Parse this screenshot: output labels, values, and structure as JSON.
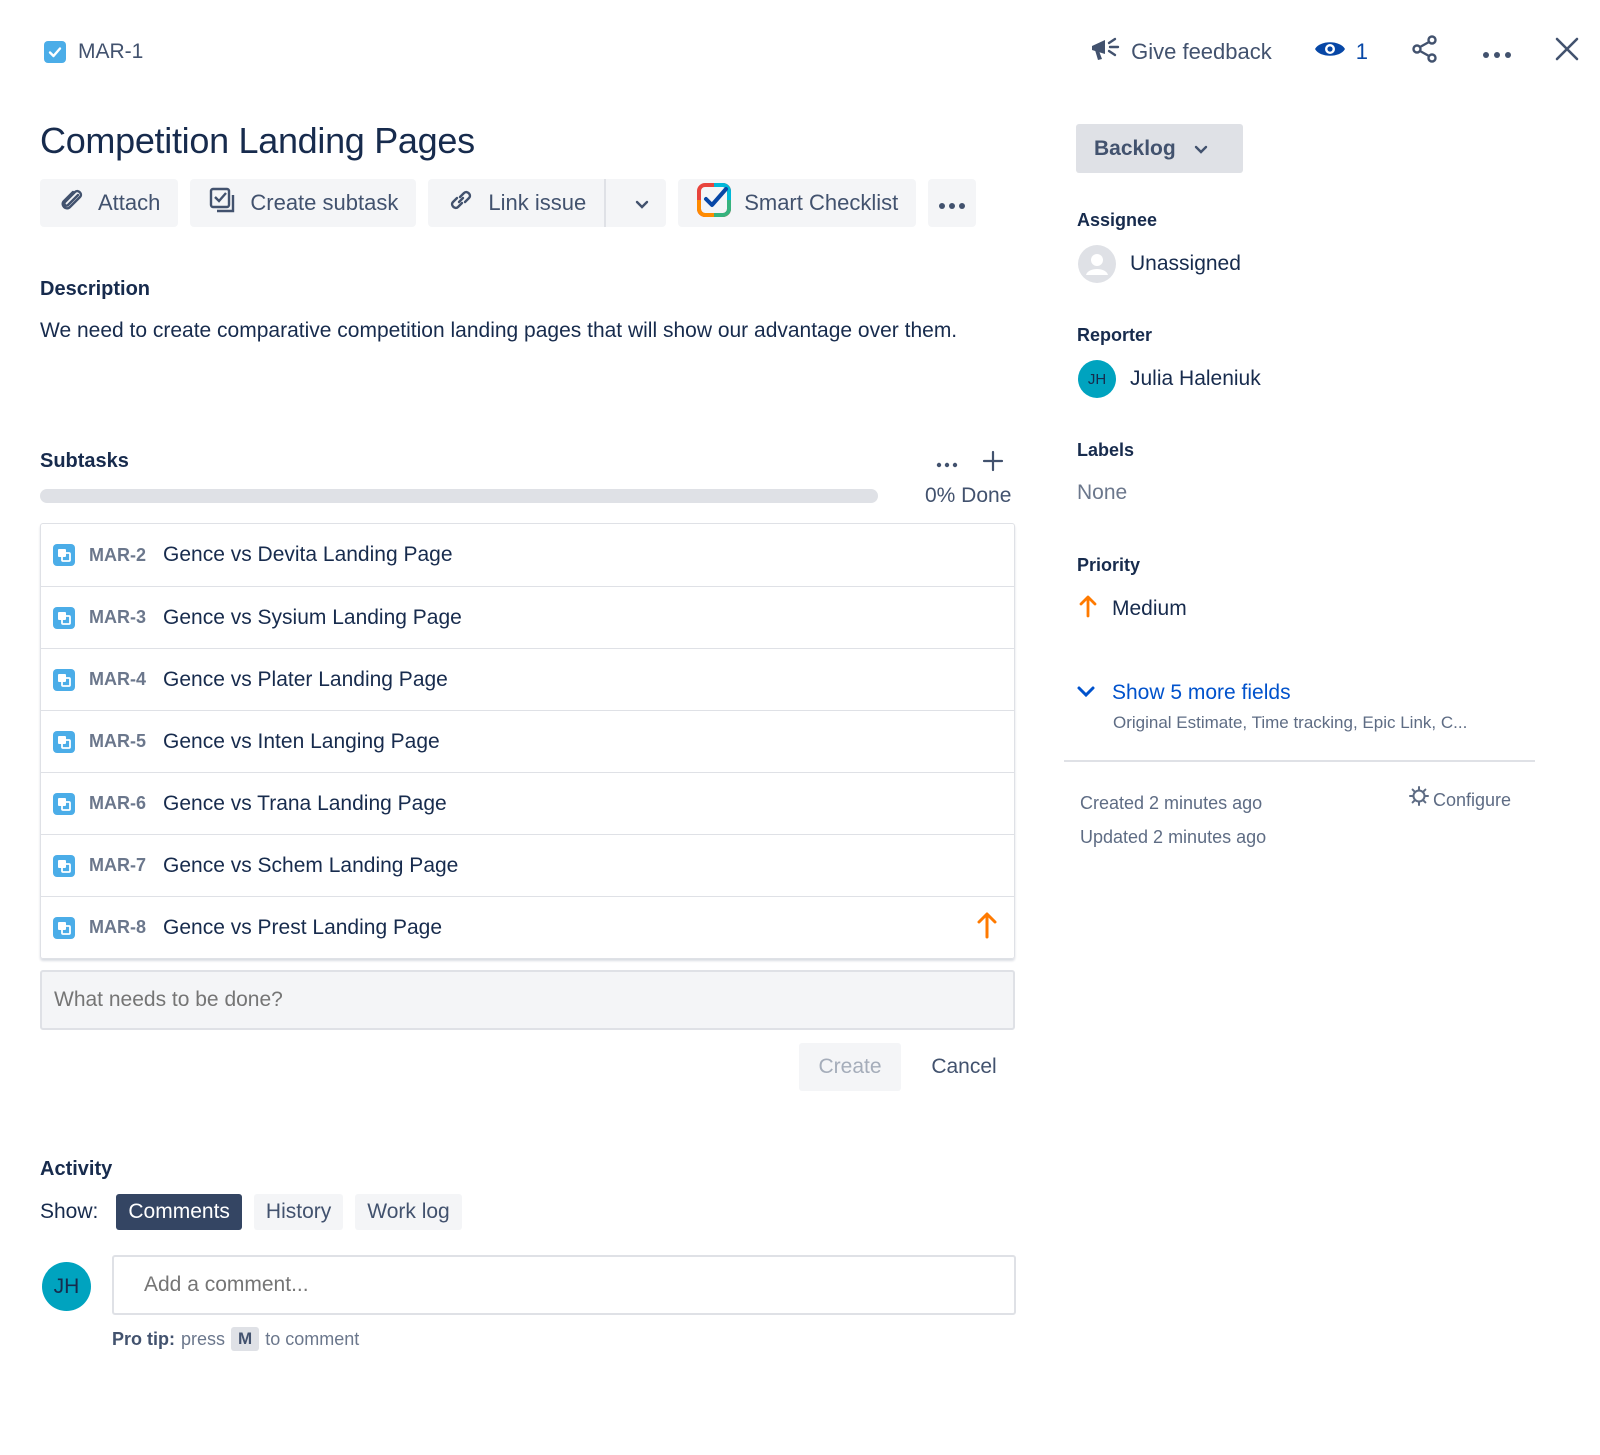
{
  "header": {
    "issue_key": "MAR-1",
    "feedback_label": "Give feedback",
    "watch_count": "1"
  },
  "issue": {
    "title": "Competition Landing Pages"
  },
  "toolbar": {
    "attach": "Attach",
    "create_subtask": "Create subtask",
    "link_issue": "Link issue",
    "smart_checklist": "Smart Checklist"
  },
  "description": {
    "heading": "Description",
    "text": "We need to create comparative competition landing pages that will show our advantage over them."
  },
  "subtasks": {
    "heading": "Subtasks",
    "progress_fraction": 0,
    "done_text": "0% Done",
    "items": [
      {
        "key": "MAR-2",
        "title": "Gence vs Devita Landing Page",
        "priority_icon": ""
      },
      {
        "key": "MAR-3",
        "title": "Gence vs Sysium Landing Page",
        "priority_icon": ""
      },
      {
        "key": "MAR-4",
        "title": "Gence vs Plater Landing Page",
        "priority_icon": ""
      },
      {
        "key": "MAR-5",
        "title": "Gence vs Inten Langing Page",
        "priority_icon": ""
      },
      {
        "key": "MAR-6",
        "title": "Gence vs Trana Landing Page",
        "priority_icon": ""
      },
      {
        "key": "MAR-7",
        "title": "Gence vs Schem Landing Page",
        "priority_icon": ""
      },
      {
        "key": "MAR-8",
        "title": "Gence vs Prest Landing Page",
        "priority_icon": "arrow-up-icon"
      }
    ],
    "new_placeholder": "What needs to be done?",
    "create_label": "Create",
    "cancel_label": "Cancel"
  },
  "activity": {
    "heading": "Activity",
    "show_label": "Show:",
    "filters": [
      "Comments",
      "History",
      "Work log"
    ],
    "active_filter": "Comments",
    "avatar_initials": "JH",
    "comment_placeholder": "Add a comment...",
    "protip_bold": "Pro tip:",
    "protip_press": "press",
    "protip_key": "M",
    "protip_rest": "to comment"
  },
  "sidebar": {
    "status": "Backlog",
    "assignee_label": "Assignee",
    "assignee_value": "Unassigned",
    "reporter_label": "Reporter",
    "reporter_initials": "JH",
    "reporter_value": "Julia Haleniuk",
    "labels_label": "Labels",
    "labels_value": "None",
    "priority_label": "Priority",
    "priority_value": "Medium",
    "more_fields": "Show 5 more fields",
    "more_fields_sub": "Original Estimate, Time tracking, Epic Link, C...",
    "created": "Created 2 minutes ago",
    "updated": "Updated 2 minutes ago",
    "configure": "Configure"
  },
  "colors": {
    "accent": "#0052cc",
    "priority_medium": "#ff7a00",
    "subtask_icon": "#4bade8",
    "active_pill": "#344563"
  }
}
